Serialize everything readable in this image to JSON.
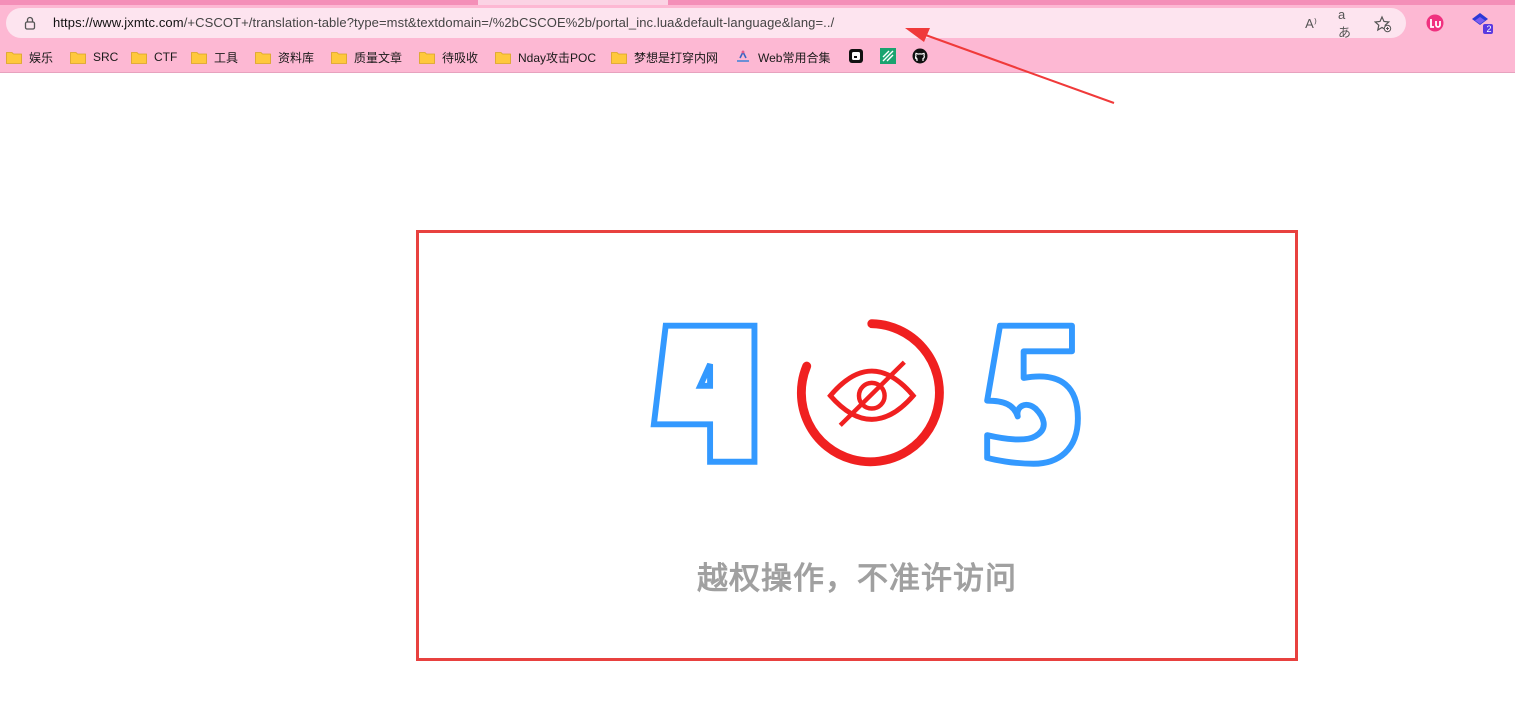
{
  "browser": {
    "url_host": "https://www.jxmtc.com",
    "url_rest": "/+CSCOT+/translation-table?type=mst&textdomain=/%2bCSCOE%2b/portal_inc.lua&default-language&lang=../",
    "read_aloud_label": "A⁾",
    "translate_label": "aあ",
    "extension_badge": "2"
  },
  "bookmarks": [
    {
      "label": "娱乐",
      "icon": "folder-icon"
    },
    {
      "label": "SRC",
      "icon": "folder-icon"
    },
    {
      "label": "CTF",
      "icon": "folder-icon"
    },
    {
      "label": "工具",
      "icon": "folder-icon"
    },
    {
      "label": "资料库",
      "icon": "folder-icon"
    },
    {
      "label": "质量文章",
      "icon": "folder-icon"
    },
    {
      "label": "待吸收",
      "icon": "folder-icon"
    },
    {
      "label": "Nday攻击POC",
      "icon": "folder-icon"
    },
    {
      "label": "梦想是打穿内网",
      "icon": "folder-icon"
    },
    {
      "label": "Web常用合集",
      "icon": "web-icon"
    }
  ],
  "error": {
    "code_left": "4",
    "code_right": "5",
    "message": "越权操作，不准许访问"
  },
  "colors": {
    "digit_blue": "#3399ff",
    "eye_red": "#f02020",
    "box_border": "#e8413f",
    "message_gray": "#a0a0a0",
    "toolbar_pink": "#fdb8d3"
  }
}
